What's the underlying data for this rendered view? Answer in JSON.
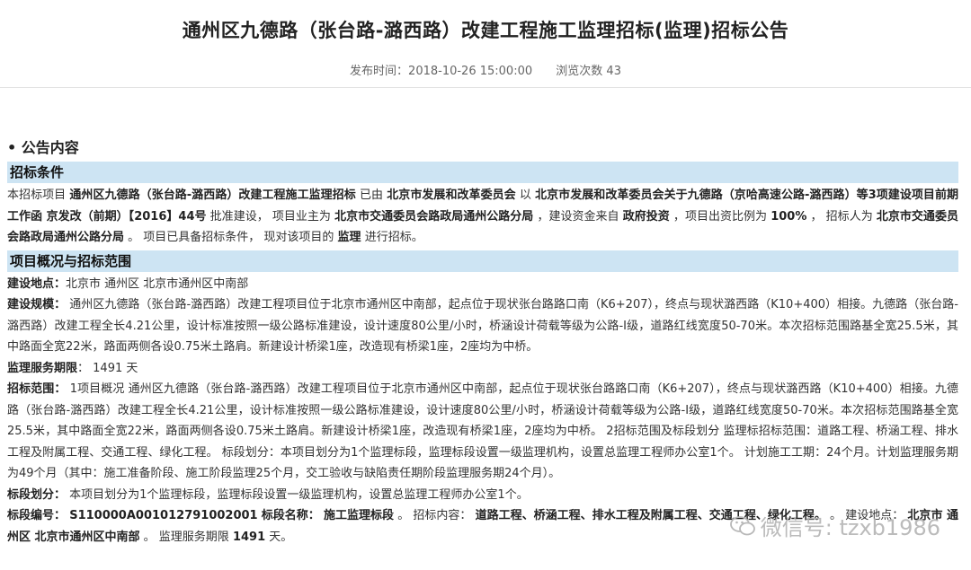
{
  "header": {
    "title": "通州区九德路（张台路-潞西路）改建工程施工监理招标(监理)招标公告",
    "publish_label": "发布时间：",
    "publish_time": "2018-10-26 15:00:00",
    "views_label": "浏览次数",
    "views_count": "43"
  },
  "section_heading": "• 公告内容",
  "bars": {
    "conditions": "招标条件",
    "overview": "项目概况与招标范围"
  },
  "conditions": {
    "t1": "本招标项目 ",
    "b1": "通州区九德路（张台路-潞西路）改建工程施工监理招标",
    "t2": " 已由 ",
    "b2": "北京市发展和改革委员会",
    "t3": " 以 ",
    "b3": "北京市发展和改革委员会关于九德路（京哈高速公路-潞西路）等3项建设项目前期工作函 京发改（前期）【2016】44号",
    "t4": " 批准建设， 项目业主为 ",
    "b4": "北京市交通委员会路政局通州公路分局",
    "t5": " ，建设资金来自 ",
    "b5": "政府投资",
    "t6": " ，项目出资比例为 ",
    "b6": "100%",
    "t7": " ， 招标人为 ",
    "b7": "北京市交通委员会路政局通州公路分局",
    "t8": " 。 项目已具备招标条件， 现对该项目的 ",
    "b8": "监理",
    "t9": " 进行招标。"
  },
  "overview": {
    "location_label": "建设地点：",
    "location_value": "北京市 通州区 北京市通州区中南部",
    "scale_label": "建设规模：",
    "scale_value": "通州区九德路（张台路-潞西路）改建工程项目位于北京市通州区中南部，起点位于现状张台路路口南（K6+207），终点与现状潞西路（K10+400）相接。九德路（张台路-潞西路）改建工程全长4.21公里，设计标准按照一级公路标准建设，设计速度80公里/小时，桥涵设计荷载等级为公路-I级，道路红线宽度50-70米。本次招标范围路基全宽25.5米，其中路面全宽22米，路面两侧各设0.75米土路肩。新建设计桥梁1座，改造现有桥梁1座，2座均为中桥。",
    "period_label": "监理服务期限",
    "period_value": "1491 天",
    "range_label": "招标范围：",
    "range_value": "1项目概况 通州区九德路（张台路-潞西路）改建工程项目位于北京市通州区中南部，起点位于现状张台路路口南（K6+207），终点与现状潞西路（K10+400）相接。九德路（张台路-潞西路）改建工程全长4.21公里，设计标准按照一级公路标准建设，设计速度80公里/小时，桥涵设计荷载等级为公路-I级，道路红线宽度50-70米。本次招标范围路基全宽25.5米，其中路面全宽22米，路面两侧各设0.75米土路肩。新建设计桥梁1座，改造现有桥梁1座，2座均为中桥。 2招标范围及标段划分 监理标招标范围：道路工程、桥涵工程、排水工程及附属工程、交通工程、绿化工程。 标段划分：本项目划分为1个监理标段，监理标段设置一级监理机构，设置总监理工程师办公室1个。 计划施工工期：24个月。计划监理服务期为49个月（其中：施工准备阶段、施工阶段监理25个月，交工验收与缺陷责任期阶段监理服务期24个月）。",
    "division_label": "标段划分：",
    "division_value": "本项目划分为1个监理标段，监理标段设置一级监理机构，设置总监理工程师办公室1个。",
    "code_label": "标段编号：",
    "code_value": "S110000A001012791002001",
    "name_label": "标段名称：",
    "name_value": "施工监理标段",
    "content_label": "招标内容：",
    "content_value": "道路工程、桥涵工程、排水工程及附属工程、交通工程、绿化工程。",
    "place_label": "建设地点：",
    "place_value": "北京市 通州区 北京市通州区中南部",
    "service_label": "监理服务期限",
    "service_value": "1491",
    "service_unit": "天。"
  },
  "watermark": {
    "text": "微信号: tzxb1986"
  }
}
